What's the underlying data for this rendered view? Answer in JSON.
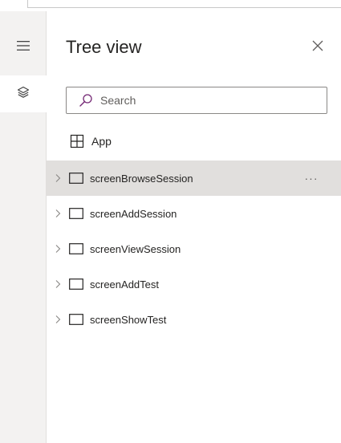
{
  "panel": {
    "title": "Tree view"
  },
  "search": {
    "placeholder": "Search",
    "value": ""
  },
  "app_item": {
    "label": "App",
    "icon": "app-grid-icon"
  },
  "screens": [
    {
      "label": "screenBrowseSession",
      "selected": true
    },
    {
      "label": "screenAddSession",
      "selected": false
    },
    {
      "label": "screenViewSession",
      "selected": false
    },
    {
      "label": "screenAddTest",
      "selected": false
    },
    {
      "label": "screenShowTest",
      "selected": false
    }
  ],
  "more_menu": {
    "glyph": "···"
  },
  "colors": {
    "accent_search_icon": "#742774",
    "selected_row": "#e1dfdd",
    "rail_bg": "#f3f2f1",
    "text": "#252423"
  },
  "icons": {
    "rail_top": "hamburger-menu-icon",
    "rail_second": "layers-icon",
    "close": "close-icon",
    "search": "search-icon",
    "expand": "chevron-right-icon",
    "screen": "screen-icon"
  }
}
